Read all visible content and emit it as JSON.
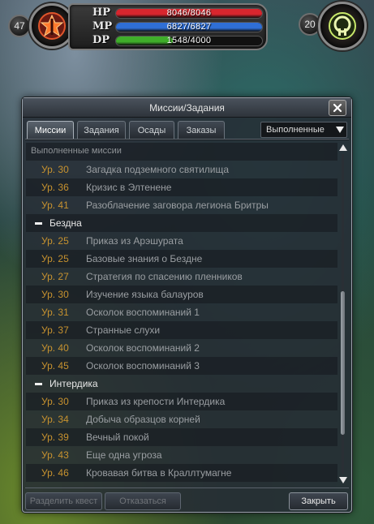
{
  "hud": {
    "player_level": "47",
    "target_level": "20",
    "hp": {
      "label": "HP",
      "text": "8046/8046",
      "value": 8046,
      "max": 8046,
      "color": "#d8262e"
    },
    "mp": {
      "label": "MP",
      "text": "6827/6827",
      "value": 6827,
      "max": 6827,
      "color": "#2f6fd6"
    },
    "dp": {
      "label": "DP",
      "text": "1548/4000",
      "value": 1548,
      "max": 4000,
      "color": "#3fae2a"
    }
  },
  "dialog": {
    "title": "Миссии/Задания",
    "tabs": [
      "Миссии",
      "Задания",
      "Осады",
      "Заказы"
    ],
    "active_tab": 0,
    "filter": {
      "selected": "Выполненные"
    },
    "list": {
      "rows": [
        {
          "kind": "header",
          "text": "Выполненные миссии"
        },
        {
          "kind": "item",
          "level": "Ур. 30",
          "name": "Загадка подземного святилища"
        },
        {
          "kind": "item",
          "level": "Ур. 36",
          "name": "Кризис в Элтенене"
        },
        {
          "kind": "item",
          "level": "Ур. 41",
          "name": "Разоблачение заговора легиона Бритры"
        },
        {
          "kind": "section",
          "text": "Бездна"
        },
        {
          "kind": "item",
          "level": "Ур. 25",
          "name": "Приказ из Арэшурата"
        },
        {
          "kind": "item",
          "level": "Ур. 25",
          "name": "Базовые знания о Бездне"
        },
        {
          "kind": "item",
          "level": "Ур. 27",
          "name": "Стратегия по спасению пленников"
        },
        {
          "kind": "item",
          "level": "Ур. 30",
          "name": "Изучение языка балауров"
        },
        {
          "kind": "item",
          "level": "Ур. 31",
          "name": "Осколок воспоминаний 1"
        },
        {
          "kind": "item",
          "level": "Ур. 37",
          "name": "Странные слухи"
        },
        {
          "kind": "item",
          "level": "Ур. 40",
          "name": "Осколок воспоминаний 2"
        },
        {
          "kind": "item",
          "level": "Ур. 45",
          "name": "Осколок воспоминаний 3"
        },
        {
          "kind": "section",
          "text": "Интердика"
        },
        {
          "kind": "item",
          "level": "Ур. 30",
          "name": "Приказ из крепости Интердика"
        },
        {
          "kind": "item",
          "level": "Ур. 34",
          "name": "Добыча образцов корней"
        },
        {
          "kind": "item",
          "level": "Ур. 39",
          "name": "Вечный покой"
        },
        {
          "kind": "item",
          "level": "Ур. 43",
          "name": "Еще одна угроза"
        },
        {
          "kind": "item",
          "level": "Ур. 46",
          "name": "Кровавая битва в Краллтумагне"
        }
      ],
      "scroll_position": 0.78,
      "visible_fraction": 0.45
    },
    "buttons": {
      "share": "Разделить квест",
      "abandon": "Отказаться",
      "close": "Закрыть"
    }
  }
}
